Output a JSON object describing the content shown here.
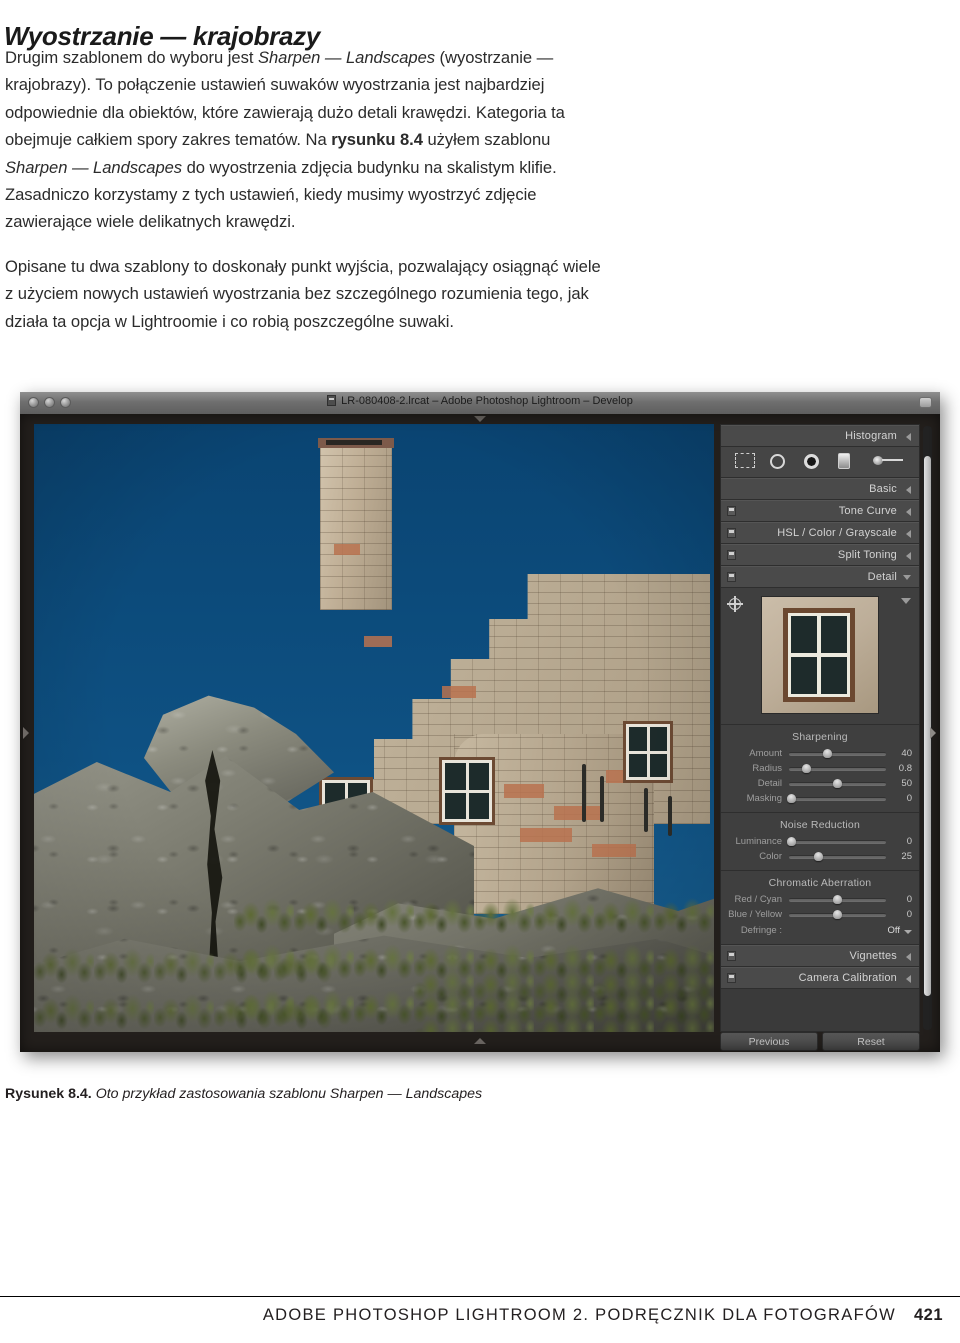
{
  "page": {
    "heading": "Wyostrzanie — krajobrazy",
    "paragraphs": [
      [
        {
          "t": "Drugim szablonem do wyboru jest ",
          "s": "n"
        },
        {
          "t": "Sharpen — Landscapes",
          "s": "i"
        },
        {
          "t": " (wyostrzanie — krajobrazy). To połączenie ustawień suwaków wyostrzania jest najbardziej odpowiednie dla obiektów, które zawierają dużo detali krawędzi. Kategoria ta obejmuje całkiem spory zakres tematów. Na ",
          "s": "n"
        },
        {
          "t": "rysunku 8.4",
          "s": "b"
        },
        {
          "t": " użyłem szablonu ",
          "s": "n"
        },
        {
          "t": "Sharpen — Landscapes",
          "s": "i"
        },
        {
          "t": " do wyostrzenia zdjęcia budynku na skalistym klifie. Zasadniczo korzystamy z tych ustawień, kiedy musimy wyostrzyć zdjęcie zawierające wiele delikatnych krawędzi.",
          "s": "n"
        }
      ],
      [
        {
          "t": "Opisane tu dwa szablony to doskonały punkt wyjścia, pozwalający osiągnąć wiele z użyciem nowych ustawień wyostrzania bez szczególnego rozumienia tego, jak działa ta opcja w Lightroomie i co robią poszczególne suwaki.",
          "s": "n"
        }
      ]
    ],
    "caption_label": "Rysunek 8.4.",
    "caption_text": " Oto przykład zastosowania szablonu Sharpen — Landscapes",
    "footer_text": "ADOBE PHOTOSHOP LIGHTROOM 2. PODRĘCZNIK DLA FOTOGRAFÓW",
    "page_number": "421"
  },
  "lightroom": {
    "titlebar": {
      "title": "LR-080408-2.lrcat – Adobe Photoshop Lightroom – Develop",
      "traffic_lights": [
        "close-button",
        "minimize-button",
        "zoom-button"
      ],
      "icon": "catalog-icon",
      "resize_button": "window-resize-button"
    },
    "photo": {
      "description": "stone building ruin on rocky cliff against deep blue sky",
      "sky_color": "#0d4a78",
      "stone_color": "#bfae95",
      "rock_color": "#7e7e72",
      "foliage_color": "#5d6a33"
    },
    "tools": [
      {
        "name": "crop-overlay-tool",
        "icon": "crop-icon"
      },
      {
        "name": "spot-removal-tool",
        "icon": "circle-icon"
      },
      {
        "name": "red-eye-correction-tool",
        "icon": "eye-icon"
      },
      {
        "name": "graduated-filter-tool",
        "icon": "gradient-icon"
      },
      {
        "name": "adjustment-brush-tool",
        "icon": "brush-icon"
      }
    ],
    "panels": [
      {
        "label": "Histogram",
        "state": "collapsed",
        "has_switch": false
      },
      {
        "label": "Basic",
        "state": "collapsed",
        "has_switch": false
      },
      {
        "label": "Tone Curve",
        "state": "collapsed",
        "has_switch": true
      },
      {
        "label": "HSL / Color / Grayscale",
        "state": "collapsed",
        "has_switch": true
      },
      {
        "label": "Split Toning",
        "state": "collapsed",
        "has_switch": true
      },
      {
        "label": "Detail",
        "state": "expanded",
        "has_switch": true
      },
      {
        "label": "Vignettes",
        "state": "collapsed",
        "has_switch": true
      },
      {
        "label": "Camera Calibration",
        "state": "collapsed",
        "has_switch": true
      }
    ],
    "detail": {
      "preview_label": "detail-zoom-preview",
      "sections": [
        {
          "title": "Sharpening",
          "sliders": [
            {
              "name": "Amount",
              "value": "40",
              "pos": 40
            },
            {
              "name": "Radius",
              "value": "0.8",
              "pos": 18
            },
            {
              "name": "Detail",
              "value": "50",
              "pos": 50
            },
            {
              "name": "Masking",
              "value": "0",
              "pos": 3
            }
          ]
        },
        {
          "title": "Noise Reduction",
          "sliders": [
            {
              "name": "Luminance",
              "value": "0",
              "pos": 3
            },
            {
              "name": "Color",
              "value": "25",
              "pos": 30
            }
          ]
        },
        {
          "title": "Chromatic Aberration",
          "sliders": [
            {
              "name": "Red / Cyan",
              "value": "0",
              "pos": 50
            },
            {
              "name": "Blue / Yellow",
              "value": "0",
              "pos": 50
            }
          ],
          "dropdown": {
            "label": "Defringe :",
            "value": "Off"
          }
        }
      ]
    },
    "buttons": {
      "previous": "Previous",
      "reset": "Reset"
    }
  }
}
